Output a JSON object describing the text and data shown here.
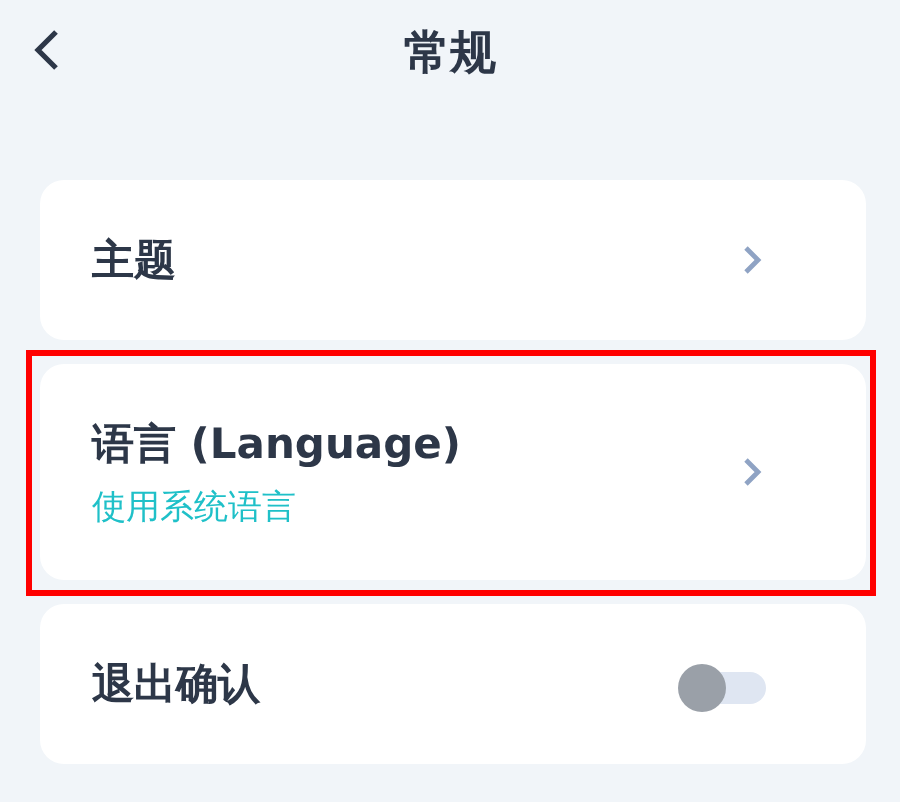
{
  "header": {
    "title": "常规"
  },
  "items": [
    {
      "kind": "link",
      "label": "主题",
      "highlighted": false
    },
    {
      "kind": "link",
      "label": "语言 (Language)",
      "subtitle": "使用系统语言",
      "highlighted": true
    },
    {
      "kind": "toggle",
      "label": "退出确认",
      "on": false,
      "highlighted": false
    }
  ]
}
